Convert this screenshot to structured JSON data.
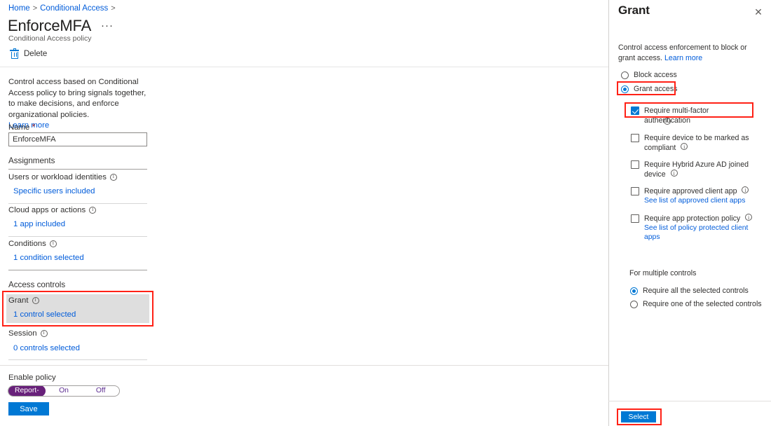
{
  "breadcrumb": {
    "items": [
      "Home",
      "Conditional Access"
    ],
    "separator": ">"
  },
  "header": {
    "title": "EnforceMFA",
    "subtitle": "Conditional Access policy",
    "ellipsis": "···"
  },
  "commandbar": {
    "delete_label": "Delete"
  },
  "intro": {
    "text": "Control access based on Conditional Access policy to bring signals together, to make decisions, and enforce organizational policies.",
    "learn_more": "Learn more"
  },
  "form": {
    "name_label": "Name",
    "name_required_mark": "*",
    "name_value": "EnforceMFA",
    "name_placeholder": "Name",
    "assignments_heading": "Assignments",
    "users_label": "Users or workload identities",
    "users_value": "Specific users included",
    "cloud_apps_label": "Cloud apps or actions",
    "cloud_apps_value": "1 app included",
    "conditions_label": "Conditions",
    "conditions_value": "1 condition selected",
    "access_controls_heading": "Access controls",
    "grant_label": "Grant",
    "grant_value": "1 control selected",
    "session_label": "Session",
    "session_value": "0 controls selected"
  },
  "footer": {
    "enable_policy_label": "Enable policy",
    "toggle_options": [
      "Report-only",
      "On",
      "Off"
    ],
    "toggle_selected": "Report-only",
    "save_label": "Save"
  },
  "panel": {
    "title": "Grant",
    "close_icon": "✕",
    "description": "Control access enforcement to block or grant access.",
    "learn_more": "Learn more",
    "access_options": [
      {
        "label": "Block access",
        "selected": false
      },
      {
        "label": "Grant access",
        "selected": true
      }
    ],
    "controls": [
      {
        "label": "Require multi-factor authentication",
        "checked": true,
        "has_info": true,
        "sublink": ""
      },
      {
        "label": "Require device to be marked as compliant",
        "checked": false,
        "has_info": true,
        "sublink": ""
      },
      {
        "label": "Require Hybrid Azure AD joined device",
        "checked": false,
        "has_info": true,
        "sublink": ""
      },
      {
        "label": "Require approved client app",
        "checked": false,
        "has_info": true,
        "sublink": "See list of approved client apps"
      },
      {
        "label": "Require app protection policy",
        "checked": false,
        "has_info": true,
        "sublink": "See list of policy protected client apps"
      }
    ],
    "multiple_controls_heading": "For multiple controls",
    "multiple_controls_options": [
      {
        "label": "Require all the selected controls",
        "selected": true
      },
      {
        "label": "Require one of the selected controls",
        "selected": false
      }
    ],
    "select_label": "Select"
  },
  "colors": {
    "accent": "#0078d4",
    "link": "#015cda",
    "highlight": "#ff2116",
    "report_only": "#68217a",
    "required": "#a4262c"
  }
}
